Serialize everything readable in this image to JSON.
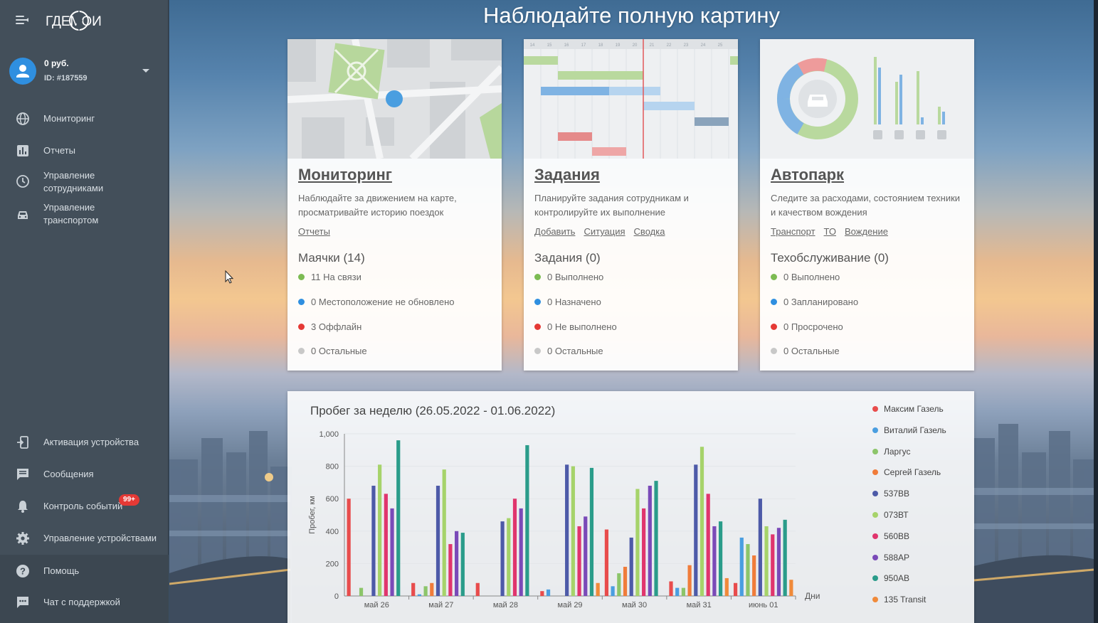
{
  "sidebar": {
    "logo_text": "ГДЕМОИ",
    "user": {
      "balance": "0 руб.",
      "id": "ID: #187559"
    },
    "nav": [
      {
        "label": "Мониторинг",
        "icon": "globe-icon"
      },
      {
        "label": "Отчеты",
        "icon": "bar-chart-icon"
      },
      {
        "label": "Управление сотрудниками",
        "icon": "clock-icon"
      },
      {
        "label": "Управление транспортом",
        "icon": "car-icon"
      }
    ],
    "bottom_nav": [
      {
        "label": "Активация устройства",
        "icon": "device-add-icon"
      },
      {
        "label": "Сообщения",
        "icon": "message-icon"
      },
      {
        "label": "Контроль событий",
        "icon": "bell-icon",
        "badge": "99+"
      },
      {
        "label": "Управление устройствами",
        "icon": "gear-icon"
      },
      {
        "label": "Помощь",
        "icon": "help-icon"
      },
      {
        "label": "Чат с поддержкой",
        "icon": "chat-icon"
      }
    ]
  },
  "main": {
    "title": "Наблюдайте полную картину",
    "cards": [
      {
        "title": "Мониторинг",
        "desc": "Наблюдайте за движением на карте, просматривайте историю поездок",
        "links": [
          "Отчеты"
        ],
        "stats_title": "Маячки (14)",
        "stats": [
          "11 На связи",
          "0 Местоположение не обновлено",
          "3 Оффлайн",
          "0 Остальные"
        ]
      },
      {
        "title": "Задания",
        "desc": "Планируйте задания сотрудникам и контролируйте их выполнение",
        "links": [
          "Добавить",
          "Ситуация",
          "Сводка"
        ],
        "stats_title": "Задания (0)",
        "stats": [
          "0 Выполнено",
          "0 Назначено",
          "0 Не выполнено",
          "0 Остальные"
        ]
      },
      {
        "title": "Автопарк",
        "desc": "Следите за расходами, состоянием техники и качеством вождения",
        "links": [
          "Транспорт",
          "ТО",
          "Вождение"
        ],
        "stats_title": "Техобслуживание (0)",
        "stats": [
          "0 Выполнено",
          "0 Запланировано",
          "0 Просрочено",
          "0 Остальные"
        ]
      }
    ],
    "status_colors": [
      "#7cbb52",
      "#2f8fe0",
      "#e53935",
      "#c8c8c8"
    ],
    "gantt_days": [
      "14",
      "15",
      "16",
      "17",
      "18",
      "19",
      "20",
      "21",
      "22",
      "23",
      "24",
      "25"
    ]
  },
  "chart_data": {
    "type": "bar",
    "title": "Пробег за неделю (26.05.2022 - 01.06.2022)",
    "xlabel": "Дни",
    "ylabel": "Пробег, км",
    "ylim": [
      0,
      1000
    ],
    "yticks": [
      "0",
      "200",
      "400",
      "600",
      "800",
      "1,000"
    ],
    "categories": [
      "май 26",
      "май 27",
      "май 28",
      "май 29",
      "май 30",
      "май 31",
      "июнь 01"
    ],
    "series": [
      {
        "name": "Максим Газель",
        "color": "#e84c4c",
        "values": [
          600,
          80,
          80,
          30,
          410,
          90,
          80
        ]
      },
      {
        "name": "Виталий Газель",
        "color": "#4a9ee0",
        "values": [
          0,
          10,
          0,
          40,
          60,
          50,
          360
        ]
      },
      {
        "name": "Ларгус",
        "color": "#8cc56a",
        "values": [
          50,
          60,
          0,
          0,
          140,
          50,
          320
        ]
      },
      {
        "name": "Сергей Газель",
        "color": "#f07c3a",
        "values": [
          0,
          80,
          0,
          0,
          180,
          190,
          250
        ]
      },
      {
        "name": "537ВВ",
        "color": "#4d5aa8",
        "values": [
          680,
          680,
          460,
          810,
          360,
          810,
          600
        ]
      },
      {
        "name": "073ВТ",
        "color": "#a6d36a",
        "values": [
          810,
          780,
          480,
          800,
          660,
          920,
          430
        ]
      },
      {
        "name": "560ВВ",
        "color": "#e0356d",
        "values": [
          630,
          320,
          600,
          430,
          540,
          630,
          380
        ]
      },
      {
        "name": "588АР",
        "color": "#7a4ab8",
        "values": [
          540,
          400,
          540,
          490,
          680,
          430,
          420
        ]
      },
      {
        "name": "950АВ",
        "color": "#2a9c8a",
        "values": [
          960,
          390,
          930,
          790,
          710,
          460,
          470
        ]
      },
      {
        "name": "135 Transit",
        "color": "#f08a3a",
        "values": [
          0,
          0,
          0,
          80,
          0,
          110,
          100
        ]
      }
    ]
  }
}
